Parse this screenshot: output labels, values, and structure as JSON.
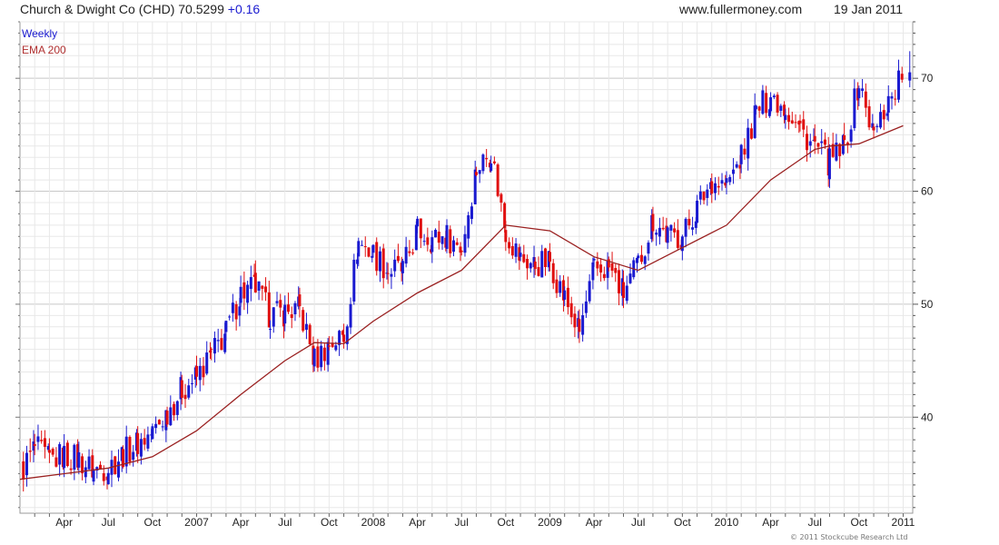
{
  "header": {
    "title": "Church & Dwight Co (CHD) 70.5299",
    "change": "+0.16",
    "website": "www.fullermoney.com",
    "date": "19 Jan 2011"
  },
  "footer": {
    "credit": "© 2011 Stockcube Research Ltd"
  },
  "colors": {
    "up": "#1a1ad0",
    "down": "#e01010",
    "ema": "#9a2020",
    "grid_major": "#c8c8c8",
    "grid_minor": "#e8e8e8"
  },
  "chart_data": {
    "type": "candlestick",
    "frequency": "Weekly",
    "legend": [
      "Weekly",
      "EMA 200"
    ],
    "x_tick_labels": [
      "Apr",
      "Jul",
      "Oct",
      "2007",
      "Apr",
      "Jul",
      "Oct",
      "2008",
      "Apr",
      "Jul",
      "Oct",
      "2009",
      "Apr",
      "Jul",
      "Oct",
      "2010",
      "Apr",
      "Jul",
      "Oct",
      "2011"
    ],
    "y_tick_labels": [
      40,
      50,
      60,
      70
    ],
    "ylim": [
      31.5,
      75
    ],
    "x_range": [
      "2006-01",
      "2011-01"
    ],
    "close_points": [
      {
        "x": "2006-01",
        "y": 35.0
      },
      {
        "x": "2006-02",
        "y": 37.3
      },
      {
        "x": "2006-03",
        "y": 36.2
      },
      {
        "x": "2006-04",
        "y": 36.6
      },
      {
        "x": "2006-05",
        "y": 36.3
      },
      {
        "x": "2006-06",
        "y": 35.3
      },
      {
        "x": "2006-07",
        "y": 35.6
      },
      {
        "x": "2006-08",
        "y": 36.8
      },
      {
        "x": "2006-09",
        "y": 37.7
      },
      {
        "x": "2006-10",
        "y": 38.6
      },
      {
        "x": "2006-11",
        "y": 40.5
      },
      {
        "x": "2006-12",
        "y": 42.5
      },
      {
        "x": "2007-01",
        "y": 43.5
      },
      {
        "x": "2007-02",
        "y": 45.5
      },
      {
        "x": "2007-03",
        "y": 47.5
      },
      {
        "x": "2007-04",
        "y": 51.0
      },
      {
        "x": "2007-05",
        "y": 51.5
      },
      {
        "x": "2007-06",
        "y": 49.0
      },
      {
        "x": "2007-07",
        "y": 49.3
      },
      {
        "x": "2007-08",
        "y": 49.5
      },
      {
        "x": "2007-09",
        "y": 45.0
      },
      {
        "x": "2007-10",
        "y": 46.5
      },
      {
        "x": "2007-11",
        "y": 47.2
      },
      {
        "x": "2007-12",
        "y": 55.5
      },
      {
        "x": "2008-01",
        "y": 54.5
      },
      {
        "x": "2008-02",
        "y": 53.0
      },
      {
        "x": "2008-03",
        "y": 53.0
      },
      {
        "x": "2008-04",
        "y": 56.5
      },
      {
        "x": "2008-05",
        "y": 55.8
      },
      {
        "x": "2008-06",
        "y": 56.0
      },
      {
        "x": "2008-07",
        "y": 55.0
      },
      {
        "x": "2008-08",
        "y": 62.0
      },
      {
        "x": "2008-09",
        "y": 63.5
      },
      {
        "x": "2008-10",
        "y": 56.5
      },
      {
        "x": "2008-11",
        "y": 54.0
      },
      {
        "x": "2008-12",
        "y": 53.5
      },
      {
        "x": "2009-01",
        "y": 53.8
      },
      {
        "x": "2009-02",
        "y": 50.5
      },
      {
        "x": "2009-03",
        "y": 47.5
      },
      {
        "x": "2009-04",
        "y": 53.0
      },
      {
        "x": "2009-05",
        "y": 53.2
      },
      {
        "x": "2009-06",
        "y": 51.0
      },
      {
        "x": "2009-07",
        "y": 53.5
      },
      {
        "x": "2009-08",
        "y": 57.5
      },
      {
        "x": "2009-09",
        "y": 56.0
      },
      {
        "x": "2009-10",
        "y": 56.0
      },
      {
        "x": "2009-11",
        "y": 58.5
      },
      {
        "x": "2009-12",
        "y": 61.0
      },
      {
        "x": "2010-01",
        "y": 60.5
      },
      {
        "x": "2010-02",
        "y": 63.0
      },
      {
        "x": "2010-03",
        "y": 67.0
      },
      {
        "x": "2010-04",
        "y": 68.5
      },
      {
        "x": "2010-05",
        "y": 67.5
      },
      {
        "x": "2010-06",
        "y": 65.5
      },
      {
        "x": "2010-07",
        "y": 64.0
      },
      {
        "x": "2010-08",
        "y": 62.5
      },
      {
        "x": "2010-09",
        "y": 64.0
      },
      {
        "x": "2010-10",
        "y": 69.5
      },
      {
        "x": "2010-11",
        "y": 65.0
      },
      {
        "x": "2010-12",
        "y": 68.0
      },
      {
        "x": "2011-01",
        "y": 70.5
      }
    ],
    "ema_200": [
      {
        "x": "2006-01",
        "y": 34.5
      },
      {
        "x": "2006-04",
        "y": 35.0
      },
      {
        "x": "2006-07",
        "y": 35.5
      },
      {
        "x": "2006-10",
        "y": 36.5
      },
      {
        "x": "2007-01",
        "y": 38.8
      },
      {
        "x": "2007-04",
        "y": 42.0
      },
      {
        "x": "2007-07",
        "y": 45.0
      },
      {
        "x": "2007-09",
        "y": 46.6
      },
      {
        "x": "2007-11",
        "y": 46.5
      },
      {
        "x": "2008-01",
        "y": 48.5
      },
      {
        "x": "2008-04",
        "y": 51.0
      },
      {
        "x": "2008-07",
        "y": 53.0
      },
      {
        "x": "2008-10",
        "y": 57.0
      },
      {
        "x": "2009-01",
        "y": 56.5
      },
      {
        "x": "2009-04",
        "y": 54.2
      },
      {
        "x": "2009-07",
        "y": 53.0
      },
      {
        "x": "2009-10",
        "y": 55.0
      },
      {
        "x": "2010-01",
        "y": 57.0
      },
      {
        "x": "2010-04",
        "y": 61.0
      },
      {
        "x": "2010-07",
        "y": 63.7
      },
      {
        "x": "2010-08",
        "y": 64.0
      },
      {
        "x": "2010-10",
        "y": 64.2
      },
      {
        "x": "2011-01",
        "y": 65.8
      }
    ]
  }
}
